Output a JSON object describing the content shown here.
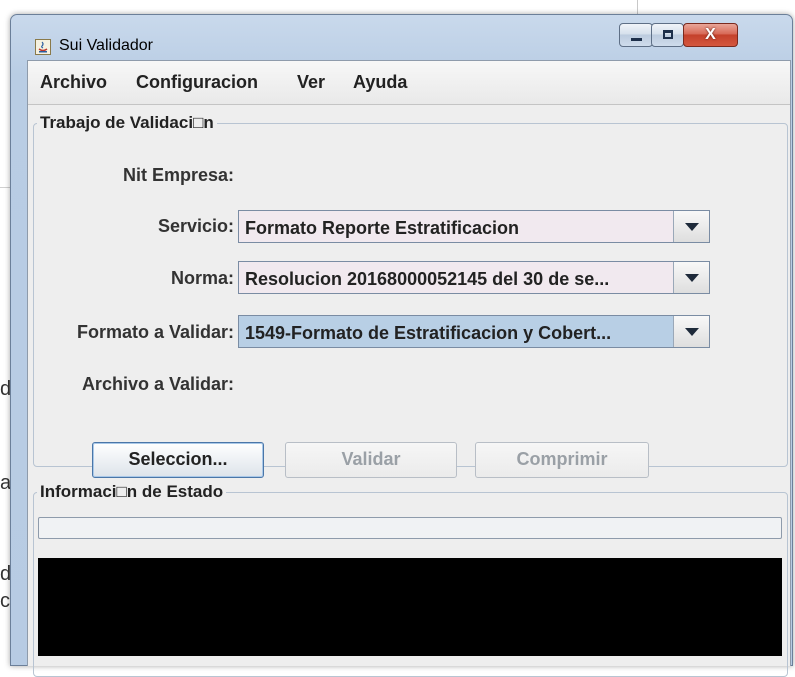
{
  "window": {
    "title": "Sui Validador",
    "close_glyph": "X"
  },
  "menu": {
    "items": [
      "Archivo",
      "Configuracion",
      "Ver",
      "Ayuda"
    ]
  },
  "trabajo": {
    "legend": "Trabajo de Validaci□n",
    "nit_label": "Nit Empresa:",
    "servicio_label": "Servicio:",
    "servicio_value": "Formato Reporte Estratificacion",
    "norma_label": "Norma:",
    "norma_value": "Resolucion 20168000052145 del 30 de se...",
    "formato_label": "Formato a Validar:",
    "formato_value": "1549-Formato de Estratificacion y Cobert...",
    "archivo_label": "Archivo a Validar:",
    "buttons": {
      "seleccion": "Seleccion...",
      "validar": "Validar",
      "comprimir": "Comprimir"
    }
  },
  "estado": {
    "legend": "Informaci□n de Estado",
    "progress": 0
  },
  "background": {
    "chars": [
      "d",
      "a",
      "d",
      "c"
    ]
  },
  "colors": {
    "combo_selected": "#b8cfe5",
    "combo_bg": "#f1e9ef",
    "console_bg": "#000000",
    "close_button": "#c4412b"
  }
}
